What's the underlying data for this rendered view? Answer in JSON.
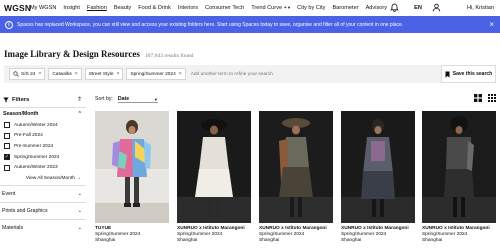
{
  "nav": {
    "logo": "WGSN",
    "items": [
      {
        "label": "My WGSN",
        "dropdown": false,
        "active": false
      },
      {
        "label": "Insight",
        "dropdown": false,
        "active": false
      },
      {
        "label": "Fashion",
        "dropdown": false,
        "active": true
      },
      {
        "label": "Beauty",
        "dropdown": false,
        "active": false
      },
      {
        "label": "Food & Drink",
        "dropdown": false,
        "active": false
      },
      {
        "label": "Interiors",
        "dropdown": false,
        "active": false
      },
      {
        "label": "Consumer Tech",
        "dropdown": false,
        "active": false
      },
      {
        "label": "Trend Curve +",
        "dropdown": true,
        "active": false
      },
      {
        "label": "City by City",
        "dropdown": false,
        "active": false
      },
      {
        "label": "Barometer",
        "dropdown": false,
        "active": false
      },
      {
        "label": "Advisory",
        "dropdown": false,
        "active": false
      }
    ],
    "language": "EN",
    "user_greeting": "Hi, Kristian",
    "icons": {
      "notifications": "bell-icon",
      "user": "user-icon"
    }
  },
  "banner": {
    "text": "Spaces has replaced Workspace, you can still view and access your existing folders here. Start using Spaces today to save, organise and filter all of your content in one place.",
    "icon": "info-icon",
    "color": "#4a63e4"
  },
  "page": {
    "title": "Image Library & Design Resources",
    "results": "107,643 results found"
  },
  "search": {
    "chips": [
      {
        "label": "S/S 24",
        "icon": "search-icon"
      },
      {
        "label": "Catwalks"
      },
      {
        "label": "Street Style"
      },
      {
        "label": "Spring/Summer 2024"
      }
    ],
    "placeholder": "Add another term to refine your search",
    "save_label": "Save this search"
  },
  "filters": {
    "title": "Filters",
    "season_heading": "Season/Month",
    "seasons": [
      {
        "label": "Autumn/Winter 2024",
        "checked": false
      },
      {
        "label": "Pre-Fall 2024",
        "checked": false
      },
      {
        "label": "Pre-Summer 2024",
        "checked": false
      },
      {
        "label": "Spring/Summer 2024",
        "checked": true
      },
      {
        "label": "Autumn/Winter 2023",
        "checked": false
      }
    ],
    "view_all": "View All Season/Month →",
    "sections": [
      "Event",
      "Prints and Graphics",
      "Materials"
    ]
  },
  "sort": {
    "label": "Sort by:",
    "value": "Date"
  },
  "cards": [
    {
      "title": "TUYUE",
      "season": "Spring/Summer 2024",
      "city": "Shanghai"
    },
    {
      "title": "XUNRUO x Istituto Marangoni",
      "season": "Spring/Summer 2024",
      "city": "Shanghai"
    },
    {
      "title": "XUNRUO x Istituto Marangoni",
      "season": "Spring/Summer 2024",
      "city": "Shanghai"
    },
    {
      "title": "XUNRUO x Istituto Marangoni",
      "season": "Spring/Summer 2024",
      "city": "Shanghai"
    },
    {
      "title": "XUNRUO x Istituto Marangoni",
      "season": "Spring/Summer 2024",
      "city": "Shanghai"
    }
  ]
}
